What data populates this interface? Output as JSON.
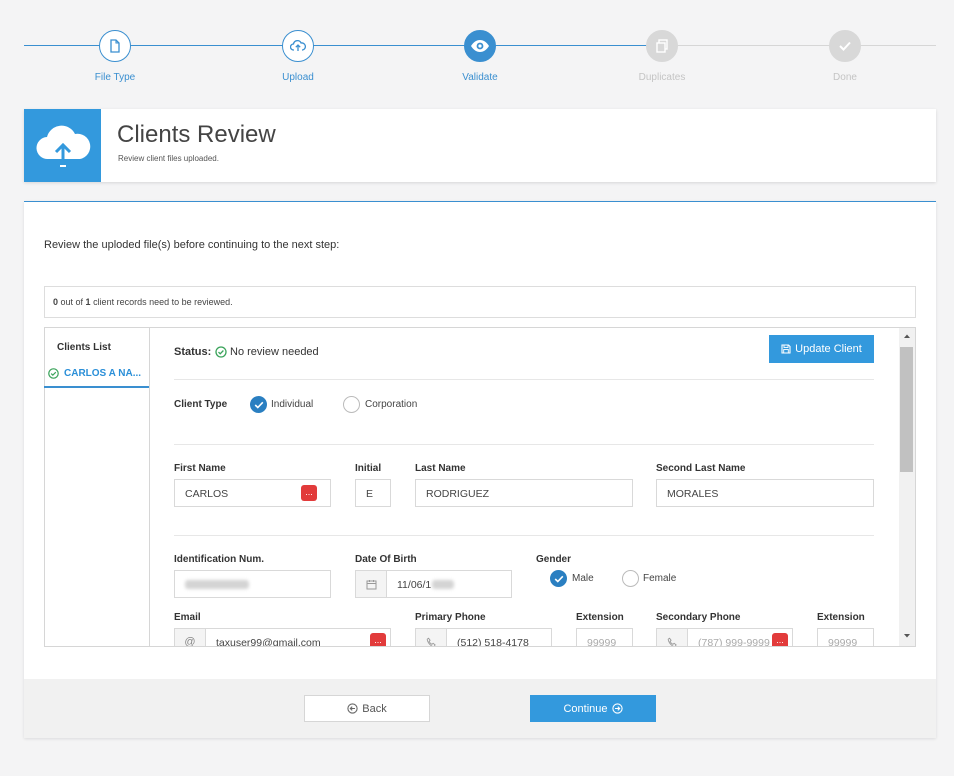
{
  "stepper": {
    "steps": [
      {
        "label": "File Type",
        "state": "done",
        "icon": "file-icon"
      },
      {
        "label": "Upload",
        "state": "done",
        "icon": "upload-icon"
      },
      {
        "label": "Validate",
        "state": "active",
        "icon": "eye-icon"
      },
      {
        "label": "Duplicates",
        "state": "inactive",
        "icon": "copy-icon"
      },
      {
        "label": "Done",
        "state": "inactive",
        "icon": "check-icon"
      }
    ]
  },
  "header": {
    "title": "Clients Review",
    "subtitle": "Review client files uploaded.",
    "icon": "cloud-upload-icon"
  },
  "main": {
    "intro": "Review the uploded file(s) before continuing to the next step:",
    "counter": {
      "count": "0",
      "mid": " out of ",
      "total": "1",
      "suffix": " client records need to be reviewed."
    },
    "clients_list": {
      "title": "Clients List",
      "items": [
        {
          "label": "CARLOS A NA..."
        }
      ]
    },
    "detail": {
      "status_label": "Status:",
      "status_value": "No review needed",
      "update_button": "Update Client",
      "client_type_label": "Client Type",
      "client_type_options": [
        "Individual",
        "Corporation"
      ],
      "client_type_selected": "Individual",
      "first_name": {
        "label": "First Name",
        "value": "CARLOS"
      },
      "initial": {
        "label": "Initial",
        "value": "E"
      },
      "last_name": {
        "label": "Last Name",
        "value": "RODRIGUEZ"
      },
      "second_last_name": {
        "label": "Second Last Name",
        "value": "MORALES"
      },
      "identification": {
        "label": "Identification Num."
      },
      "dob": {
        "label": "Date Of Birth",
        "value": "11/06/1"
      },
      "gender": {
        "label": "Gender",
        "options": [
          "Male",
          "Female"
        ],
        "selected": "Male"
      },
      "email": {
        "label": "Email",
        "prefix": "@",
        "value": "taxuser99@gmail.com"
      },
      "primary_phone": {
        "label": "Primary Phone",
        "value": "(512) 518-4178"
      },
      "extension1": {
        "label": "Extension",
        "placeholder": "99999"
      },
      "secondary_phone": {
        "label": "Secondary Phone",
        "placeholder": "(787) 999-9999"
      },
      "extension2": {
        "label": "Extension",
        "placeholder": "99999"
      },
      "badge_text": "..."
    }
  },
  "footer": {
    "back": "Back",
    "continue": "Continue"
  },
  "colors": {
    "accent": "#3399dd",
    "success": "#3aa35a",
    "danger": "#e23b3b"
  }
}
